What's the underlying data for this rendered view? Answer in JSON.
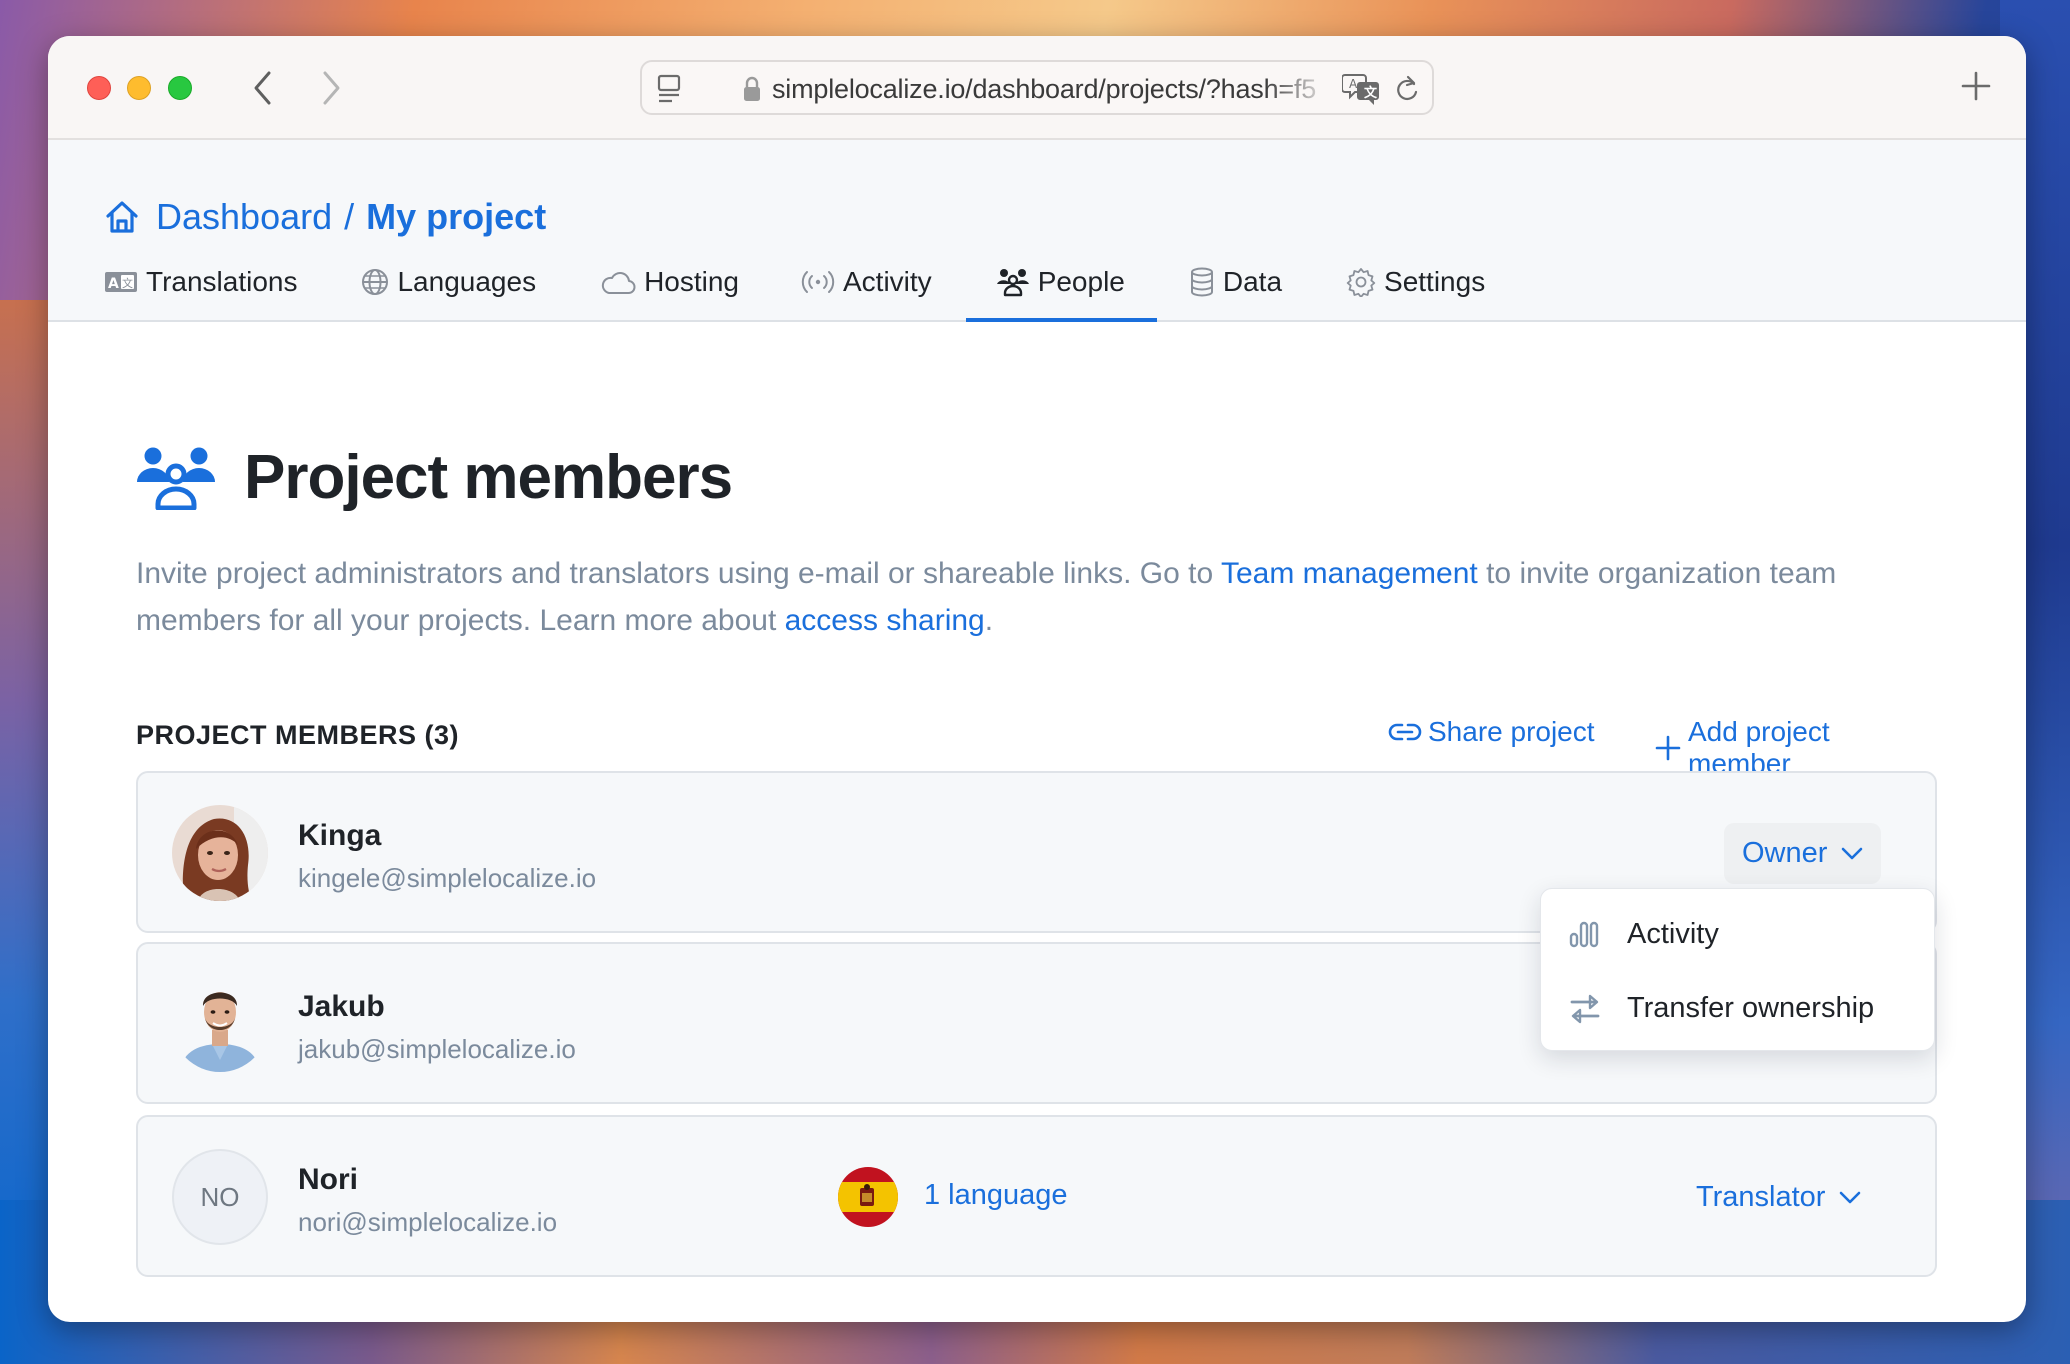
{
  "browser": {
    "url": "simplelocalize.io/dashboard/projects/?hash=f5",
    "icons": {
      "close": "traffic-light-red",
      "minimize": "traffic-light-yellow",
      "zoom": "traffic-light-green",
      "back": "chevron-left-icon",
      "forward": "chevron-right-icon",
      "sidebar": "sidebar-icon",
      "lock": "lock-icon",
      "translate": "translate-icon",
      "reload": "reload-icon",
      "new_tab": "plus-icon"
    }
  },
  "breadcrumb": {
    "home_icon": "home-icon",
    "root": "Dashboard",
    "separator": "/",
    "current": "My project"
  },
  "tabs": [
    {
      "label": "Translations",
      "icon": "translate-box-icon",
      "active": false
    },
    {
      "label": "Languages",
      "icon": "globe-icon",
      "active": false
    },
    {
      "label": "Hosting",
      "icon": "cloud-icon",
      "active": false
    },
    {
      "label": "Activity",
      "icon": "broadcast-icon",
      "active": false
    },
    {
      "label": "People",
      "icon": "people-icon",
      "active": true
    },
    {
      "label": "Data",
      "icon": "database-icon",
      "active": false
    },
    {
      "label": "Settings",
      "icon": "gear-icon",
      "active": false
    }
  ],
  "page": {
    "title": "Project members",
    "title_icon": "people-icon",
    "description": {
      "part1": "Invite project administrators and translators using e-mail or shareable links. Go to ",
      "link1": "Team management",
      "part2": " to invite organization team members for all your projects. Learn more about ",
      "link2": "access sharing",
      "part3": "."
    }
  },
  "members_section": {
    "title": "PROJECT MEMBERS (3)",
    "count": 3,
    "share_label": "Share project",
    "add_label": "Add project member"
  },
  "members": [
    {
      "name": "Kinga",
      "email": "kingele@simplelocalize.io",
      "avatar": "photo",
      "role": "Owner"
    },
    {
      "name": "Jakub",
      "email": "jakub@simplelocalize.io",
      "avatar": "photo",
      "role": ""
    },
    {
      "name": "Nori",
      "email": "nori@simplelocalize.io",
      "avatar_initials": "NO",
      "languages_label": "1 language",
      "language_flag": "es",
      "role": "Translator"
    }
  ],
  "dropdown": {
    "items": [
      {
        "label": "Activity",
        "icon": "bar-chart-icon"
      },
      {
        "label": "Transfer ownership",
        "icon": "transfer-arrows-icon"
      }
    ]
  },
  "colors": {
    "accent": "#1a6fdc",
    "text": "#1f2328",
    "muted": "#7b8a9c",
    "card_bg": "#f6f8fa"
  }
}
